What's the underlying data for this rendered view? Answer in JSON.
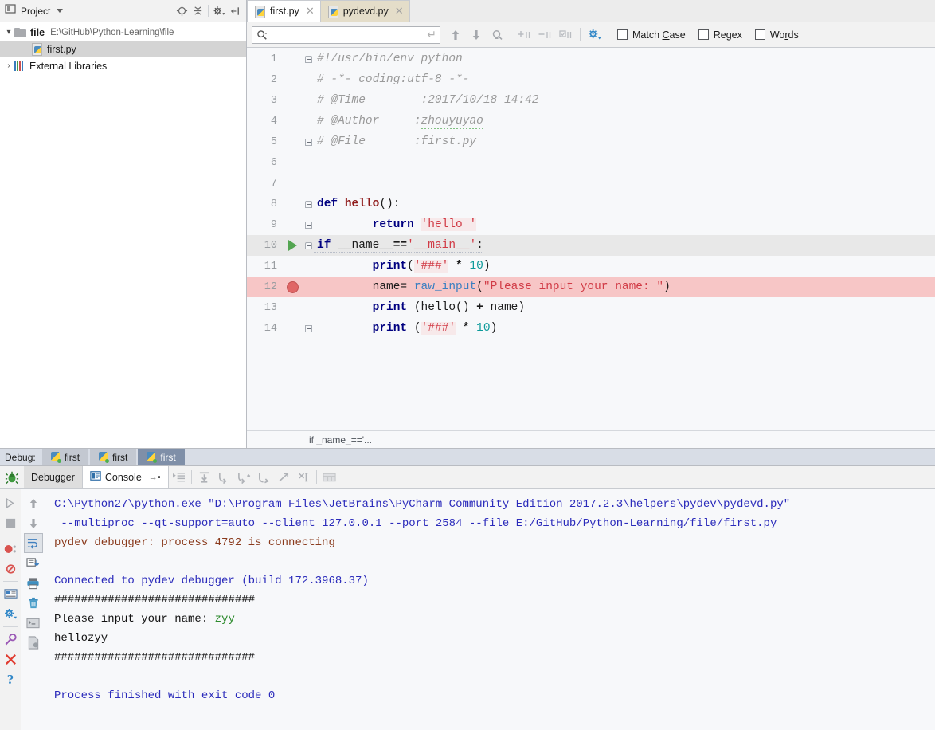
{
  "project": {
    "title": "Project",
    "icons": [
      "project-view-icon",
      "dropdown-caret",
      "locate-icon",
      "collapse-all-icon",
      "settings-gear-icon",
      "hide-icon"
    ],
    "tree": [
      {
        "twisty": "⌄",
        "icon": "folder-icon",
        "label": "file",
        "path": "E:\\GitHub\\Python-Learning\\file",
        "bold": true,
        "selected": false,
        "depth": 0
      },
      {
        "twisty": "",
        "icon": "python-file-icon",
        "label": "first.py",
        "path": "",
        "bold": false,
        "selected": true,
        "depth": 1
      },
      {
        "twisty": "›",
        "icon": "libraries-icon",
        "label": "External Libraries",
        "path": "",
        "bold": false,
        "selected": false,
        "depth": 0
      }
    ]
  },
  "editor": {
    "tabs": [
      {
        "label": "first.py",
        "active": true
      },
      {
        "label": "pydevd.py",
        "active": false
      }
    ],
    "breadcrumb": "if _name_=='...",
    "find": {
      "value": "",
      "placeholder": "",
      "checkboxes": [
        {
          "pre": "Match ",
          "mn": "C",
          "post": "ase",
          "checked": false
        },
        {
          "pre": "Re",
          "mn": "g",
          "post": "ex",
          "checked": false
        },
        {
          "pre": "Wo",
          "mn": "r",
          "post": "ds",
          "checked": false
        }
      ],
      "buttons": [
        "find-previous-icon",
        "find-next-icon",
        "find-in-selection-icon",
        "add-icon",
        "remove-icon",
        "select-all-icon",
        "find-settings-gear-icon"
      ]
    },
    "lines": [
      {
        "n": "1",
        "fold": "top",
        "state": "",
        "gutter": ""
      },
      {
        "n": "2",
        "fold": "bar",
        "state": "",
        "gutter": ""
      },
      {
        "n": "3",
        "fold": "bar",
        "state": "",
        "gutter": ""
      },
      {
        "n": "4",
        "fold": "bar",
        "state": "",
        "gutter": ""
      },
      {
        "n": "5",
        "fold": "end",
        "state": "",
        "gutter": ""
      },
      {
        "n": "6",
        "fold": "",
        "state": "",
        "gutter": ""
      },
      {
        "n": "7",
        "fold": "",
        "state": "",
        "gutter": ""
      },
      {
        "n": "8",
        "fold": "top",
        "state": "",
        "gutter": ""
      },
      {
        "n": "9",
        "fold": "end",
        "state": "",
        "gutter": ""
      },
      {
        "n": "10",
        "fold": "top",
        "state": "current",
        "gutter": "run-arrow"
      },
      {
        "n": "11",
        "fold": "bar",
        "state": "",
        "gutter": ""
      },
      {
        "n": "12",
        "fold": "bar",
        "state": "bp",
        "gutter": "breakpoint"
      },
      {
        "n": "13",
        "fold": "bar",
        "state": "",
        "gutter": ""
      },
      {
        "n": "14",
        "fold": "end",
        "state": "",
        "gutter": ""
      }
    ],
    "code_text": {
      "l1": "#!/usr/bin/env python",
      "l2": "# -*- coding:utf-8 -*-",
      "l3": "# @Time        :2017/10/18 14:42",
      "l4_a": "# @Author     :",
      "l4_b": "zhouyuyao",
      "l5": "# @File       :first.py",
      "l8_def": "def ",
      "l8_name": "hello",
      "l8_tail": "():",
      "l9_kw": "return ",
      "l9_str": "'hello '",
      "l10_if": "if ",
      "l10_name": "__name__",
      "l10_eq": "==",
      "l10_main": "'__main__'",
      "l10_colon": ":",
      "l11_print": "print",
      "l11_p1": "(",
      "l11_str": "'###'",
      "l11_star": " * ",
      "l11_num": "10",
      "l11_p2": ")",
      "l12_var": "name= ",
      "l12_fn": "raw_input",
      "l12_p1": "(",
      "l12_str": "\"Please input your name: \"",
      "l12_p2": ")",
      "l13_print": "print",
      "l13_rest": " (hello() ",
      "l13_plus": "+",
      "l13_tail": " name)",
      "l14_print": "print",
      "l14_p1": " (",
      "l14_str": "'###'",
      "l14_star": " * ",
      "l14_num": "10",
      "l14_p2": ")"
    }
  },
  "debug": {
    "label": "Debug:",
    "sessions": [
      {
        "label": "first",
        "active": false
      },
      {
        "label": "first",
        "active": false
      },
      {
        "label": "first",
        "active": true
      }
    ],
    "tabs": [
      {
        "label": "Debugger",
        "active": false,
        "icon": ""
      },
      {
        "label": "Console",
        "active": true,
        "icon": "console-icon",
        "suffix": "→▪"
      }
    ],
    "step_icons": [
      "show-execution-point-icon",
      "step-over-icon",
      "step-into-icon",
      "force-step-into-icon",
      "step-out-icon",
      "run-to-cursor-icon",
      "evaluate-expression-icon",
      "view-breakpoints-table-icon"
    ],
    "left_rail_icons": [
      "resume-program-icon",
      "stop-icon",
      "view-breakpoints-icon",
      "mute-breakpoints-icon",
      "restore-layout-icon",
      "settings-gear-icon",
      "pin-tab-icon",
      "close-icon",
      "help-icon"
    ],
    "second_rail_icons": [
      "scroll-up-icon",
      "scroll-down-icon",
      "soft-wrap-icon",
      "scroll-to-end-icon",
      "print-icon",
      "clear-all-icon",
      "console-history-icon",
      "export-icon"
    ],
    "console": {
      "line1_a": "C:\\Python27\\python.exe \"D:\\Program Files\\JetBrains\\PyCharm Community Edition 2017.2.3\\helpers\\pydev\\pydevd.py\"",
      "line2": " --multiproc --qt-support=auto --client 127.0.0.1 --port 2584 --file E:/GitHub/Python-Learning/file/first.py",
      "line3": "pydev debugger: process 4792 is connecting",
      "line4": "",
      "line5": "Connected to pydev debugger (build 172.3968.37)",
      "line6": "##############################",
      "line7_prompt": "Please input your name: ",
      "line7_input": "zyy",
      "line8": "hellozyy",
      "line9": "##############################",
      "line10": "",
      "line11": "Process finished with exit code 0"
    }
  },
  "colors": {
    "breakpoint_red": "#e06666",
    "run_green": "#53a551",
    "keyword_navy": "#000080",
    "string_red": "#d13b46",
    "builtin_blue": "#3a7fc1",
    "number_teal": "#0d9a9a",
    "console_blue": "#2b2bbb",
    "console_maroon": "#8a3a1c",
    "console_green": "#2e8b2e",
    "active_session": "#7f8fa8"
  }
}
